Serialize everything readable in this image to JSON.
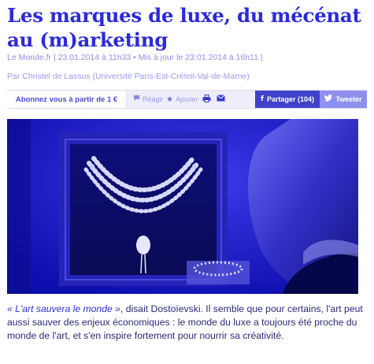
{
  "article": {
    "title": "Les marques de luxe, du mécénat au (m)arketing",
    "meta": "Le Monde.fr | 23.01.2014 à 11h33 • Mis à jour le 23.01.2014 à 16h11 |",
    "author": "Par Christel de Lassus (Université Paris-Est-Créteil-Val-de-Marne)"
  },
  "toolbar": {
    "subscribe_label": "Abonnez vous à partir de 1 €",
    "react_label": "Réagir",
    "add_label": "Ajouter",
    "print_icon": "print-icon",
    "mail_icon": "mail-icon",
    "facebook_label": "Partager (104)",
    "twitter_label": "Tweeter"
  },
  "photo": {
    "alt": "necklace-display-photo"
  },
  "body": {
    "quote": "« L'art sauvera le monde »",
    "rest": ", disait Dostoïevski. Il semble que pour certains, l'art peut aussi sauver des enjeux économiques : le monde du luxe a toujours été proche du monde de l'art, et s'en inspire fortement pour nourrir sa créativité."
  },
  "colors": {
    "title": "#2b2bd9",
    "meta": "#8f8ff0",
    "facebook": "#4141c9",
    "twitter": "#8f8fef",
    "photo_tint": "#1c1cd6"
  }
}
